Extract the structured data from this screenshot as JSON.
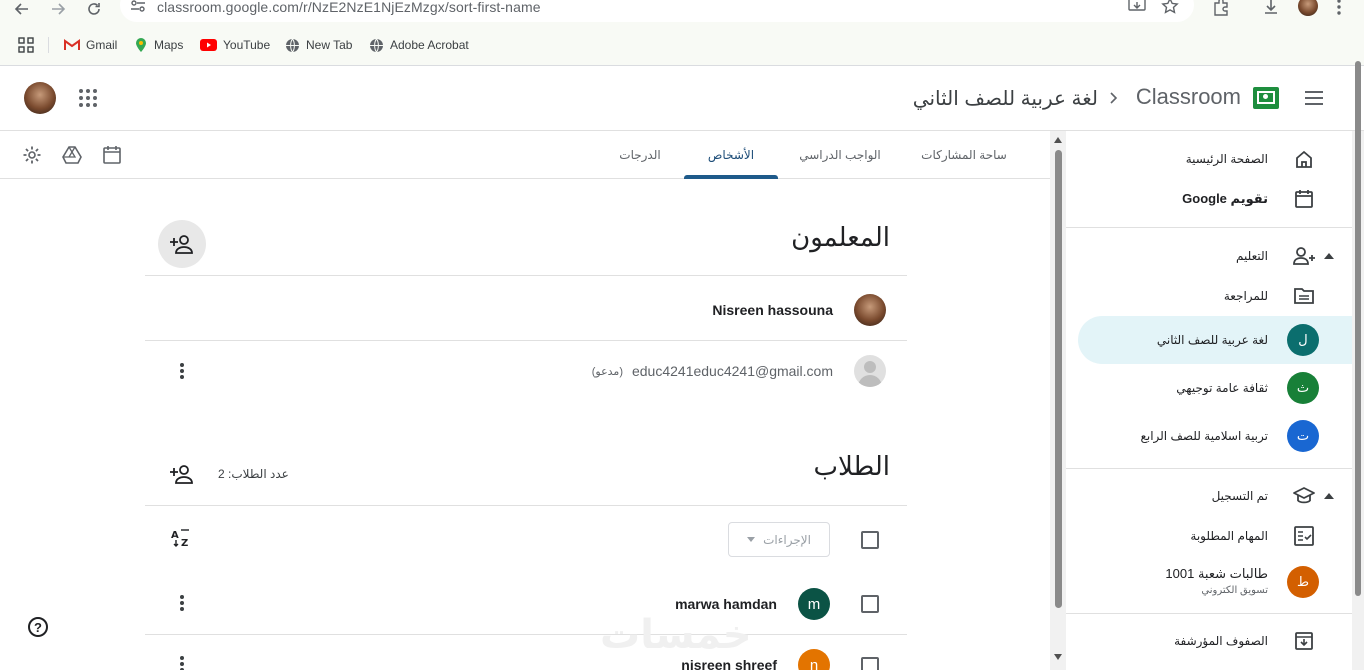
{
  "browser": {
    "url": "classroom.google.com/r/NzE2NzE1NjEzMzgx/sort-first-name",
    "bookmarks": [
      {
        "label": "Gmail",
        "icon": "gmail-icon"
      },
      {
        "label": "Maps",
        "icon": "maps-icon"
      },
      {
        "label": "YouTube",
        "icon": "youtube-icon"
      },
      {
        "label": "New Tab",
        "icon": "globe-icon"
      },
      {
        "label": "Adobe Acrobat",
        "icon": "globe-icon"
      }
    ]
  },
  "header": {
    "brand": "Classroom",
    "course_name": "لغة عربية للصف الثاني",
    "accent_color": "#1e8e3e"
  },
  "tabs": [
    {
      "label": "ساحة المشاركات",
      "active": false
    },
    {
      "label": "الواجب الدراسي",
      "active": false
    },
    {
      "label": "الأشخاص",
      "active": true
    },
    {
      "label": "الدرجات",
      "active": false
    }
  ],
  "teachers": {
    "title": "المعلمون",
    "members": [
      {
        "name": "Nisreen hassouna"
      },
      {
        "email": "educ4241educ4241@gmail.com",
        "status": "(مدعو)"
      }
    ]
  },
  "students": {
    "title": "الطلاب",
    "count_label": "عدد الطلاب: 2",
    "actions_placeholder": "الإجراءات",
    "members": [
      {
        "name": "marwa hamdan",
        "initial": "m",
        "color": "#0b5345"
      },
      {
        "name": "nisreen shreef",
        "initial": "n",
        "color": "#e37400"
      }
    ]
  },
  "sidebar": {
    "home": "الصفحة الرئيسية",
    "calendar": "تقويم Google",
    "teaching": "التعليم",
    "review": "للمراجعة",
    "teaching_classes": [
      {
        "label": "لغة عربية للصف الثاني",
        "initial": "ل",
        "color": "#0b6e6e",
        "active": true
      },
      {
        "label": "ثقافة عامة توجيهي",
        "initial": "ث",
        "color": "#188038",
        "active": false
      },
      {
        "label": "تربية اسلامية للصف الرابع",
        "initial": "ت",
        "color": "#1967d2",
        "active": false
      }
    ],
    "enrolled": "تم التسجيل",
    "todo": "المهام المطلوبة",
    "enrolled_class": {
      "label": "طالبات شعبة 1001",
      "sublabel": "تسويق الكتروني",
      "initial": "ط",
      "color": "#d35f00"
    },
    "archived": "الصفوف المؤرشفة"
  },
  "watermark": "خمسات"
}
